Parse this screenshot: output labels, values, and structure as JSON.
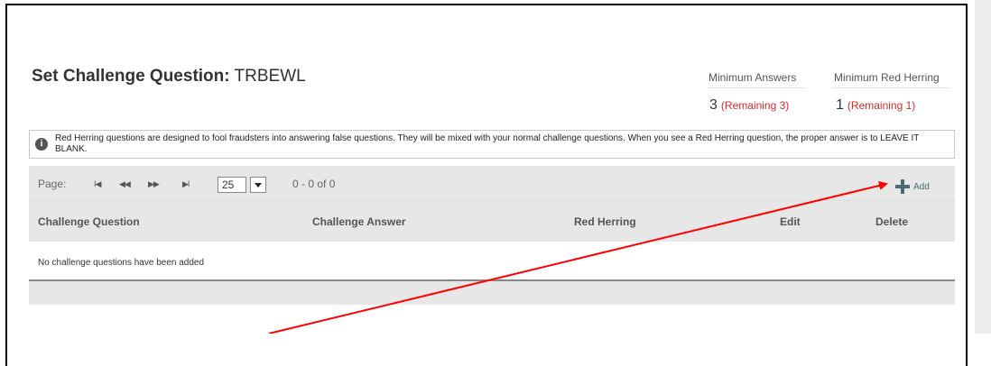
{
  "page": {
    "title_bold": "Set Challenge Question:",
    "title_code": "TRBEWL"
  },
  "stats": {
    "min_answers": {
      "label": "Minimum Answers",
      "value": "3",
      "remaining": "(Remaining 3)"
    },
    "min_red_herring": {
      "label": "Minimum Red Herring",
      "value": "1",
      "remaining": "(Remaining 1)"
    }
  },
  "info": {
    "icon": "info-icon",
    "text": "Red Herring questions are designed to fool fraudsters into answering false questions. They will be mixed with your normal challenge questions. When you see a Red Herring question, the proper answer is to LEAVE IT BLANK."
  },
  "pager": {
    "label": "Page:",
    "first": "I◀",
    "prev": "◀◀",
    "next": "▶▶",
    "last": "▶I",
    "page_size": "25",
    "count": "0 - 0 of 0"
  },
  "add_button": {
    "icon": "plus-icon",
    "label": "Add"
  },
  "table": {
    "columns": [
      "Challenge Question",
      "Challenge Answer",
      "Red Herring",
      "Edit",
      "Delete"
    ],
    "empty_message": "No challenge questions have been added"
  },
  "annotation": {
    "arrow_color": "#ff0000"
  }
}
